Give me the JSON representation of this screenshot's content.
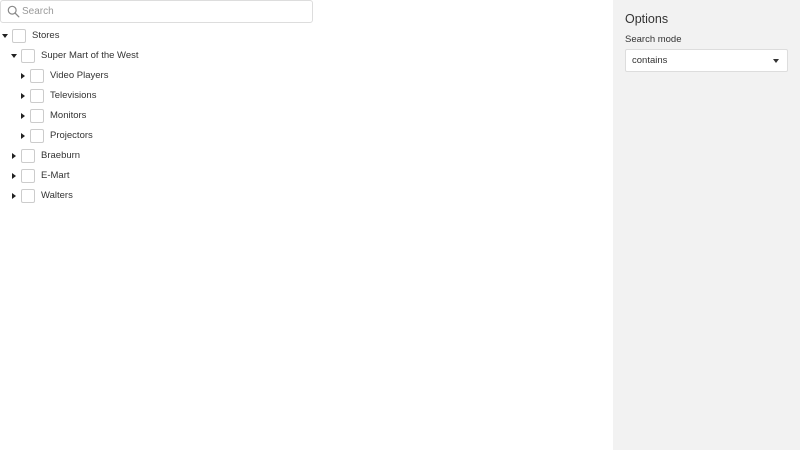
{
  "search": {
    "placeholder": "Search",
    "value": "",
    "icon": "search-icon"
  },
  "tree": {
    "root": {
      "label": "Stores",
      "expanded": true,
      "checked": false
    },
    "stores": [
      {
        "label": "Super Mart of the West",
        "expanded": true,
        "checked": false,
        "children": [
          {
            "label": "Video Players",
            "expanded": false,
            "checked": false
          },
          {
            "label": "Televisions",
            "expanded": false,
            "checked": false
          },
          {
            "label": "Monitors",
            "expanded": false,
            "checked": false
          },
          {
            "label": "Projectors",
            "expanded": false,
            "checked": false
          }
        ]
      },
      {
        "label": "Braeburn",
        "expanded": false,
        "checked": false
      },
      {
        "label": "E-Mart",
        "expanded": false,
        "checked": false
      },
      {
        "label": "Walters",
        "expanded": false,
        "checked": false
      }
    ]
  },
  "options": {
    "title": "Options",
    "search_mode_label": "Search mode",
    "search_mode_value": "contains"
  },
  "colors": {
    "options_panel_bg": "#f2f2f2",
    "border": "#dddddd",
    "text": "#333333"
  }
}
